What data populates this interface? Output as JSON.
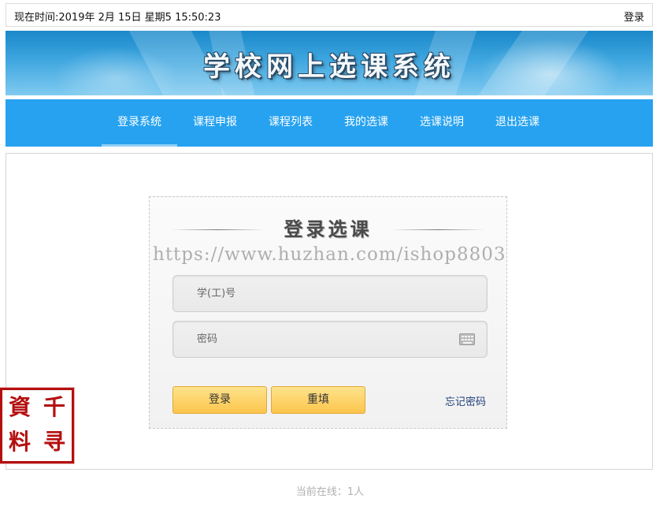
{
  "topbar": {
    "time_text": "现在时间:2019年 2月 15日 星期5 15:50:23",
    "login_link": "登录"
  },
  "banner": {
    "title": "学校网上选课系统"
  },
  "nav": {
    "items": [
      {
        "label": "登录系统",
        "active": true
      },
      {
        "label": "课程申报"
      },
      {
        "label": "课程列表"
      },
      {
        "label": "我的选课"
      },
      {
        "label": "选课说明"
      },
      {
        "label": "退出选课"
      }
    ]
  },
  "login": {
    "heading": "登录选课",
    "watermark": "https://www.huzhan.com/ishop8803",
    "user_placeholder": "学(工)号",
    "user_value": "",
    "password_placeholder": "密码",
    "password_value": "",
    "login_button": "登录",
    "reset_button": "重填",
    "forgot_link": "忘记密码",
    "keyboard_icon": "keyboard-icon"
  },
  "seal": {
    "chars": [
      "資",
      "千",
      "料",
      "寻"
    ]
  },
  "footer": {
    "online_text": "当前在线：1人"
  },
  "colors": {
    "nav": "#26a2f0",
    "button": "#fcc54c",
    "seal": "#b40f0f"
  }
}
